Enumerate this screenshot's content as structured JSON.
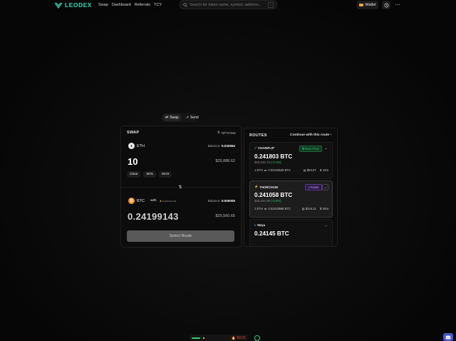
{
  "app": {
    "brand": "LEODEX",
    "brand_color": "#2fd9b3"
  },
  "nav": {
    "items": [
      "Swap",
      "Dashboard",
      "Referrals",
      "TCY"
    ]
  },
  "search": {
    "placeholder": "Search for token name, symbol, address...",
    "shortcut": "/"
  },
  "header": {
    "wallet_label": "Wallet"
  },
  "modes": {
    "swap": "Swap",
    "send": "Send"
  },
  "swap": {
    "title": "SWAP",
    "options_label": "OPTIONS",
    "from": {
      "token": "ETH",
      "balance_label": "Balance:",
      "balance": "0.032554",
      "amount": "10",
      "usd": "$25,888.62"
    },
    "quick": [
      "Clear",
      "50%",
      "MAX"
    ],
    "to": {
      "token": "BTC",
      "with_label": "with",
      "provider": "THORCHAIN",
      "balance_label": "Balance:",
      "balance": "0.000005",
      "amount": "0.24199143",
      "usd": "$25,560.65"
    },
    "select_route": "Select Route"
  },
  "routes": {
    "title": "ROUTES",
    "continue": "Continue with this route",
    "items": [
      {
        "provider": "CHAINFLIP",
        "badge": "Best Price",
        "badge_color": "#2ecc71",
        "amount": "0.241803 BTC",
        "usd": "$25,540.73",
        "diff": "(-0.1%)",
        "rate": "1 ETH",
        "rate_value": "0.02416529 BTC",
        "fee": "$84.07",
        "time": "13m"
      },
      {
        "provider": "THORCHAIN",
        "badge": "Faster",
        "badge_color": "#a45cf0",
        "amount": "0.241058 BTC",
        "usd": "$25,462.08",
        "diff": "(-0.3%)",
        "rate": "1 ETH",
        "rate_value": "0.02410588 BTC",
        "fee": "$144.11",
        "time": "04m"
      },
      {
        "provider": "Maya",
        "amount": "0.24145 BTC"
      }
    ]
  },
  "footer": {
    "gas": "$0.01"
  }
}
